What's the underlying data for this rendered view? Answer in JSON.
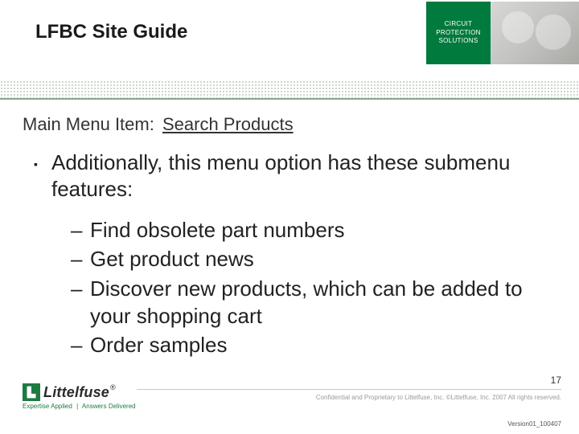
{
  "header": {
    "title": "LFBC Site Guide",
    "brand_lines": [
      "CIRCUIT",
      "PROTECTION",
      "SOLUTIONS"
    ]
  },
  "subhead": {
    "label": "Main Menu Item:",
    "value": "Search Products"
  },
  "bullet": "Additionally, this menu option has these submenu features:",
  "subitems": [
    "Find obsolete part numbers",
    "Get product news",
    "Discover new products, which can be added to your shopping cart",
    "Order samples"
  ],
  "footer": {
    "logo_word": "Littelfuse",
    "reg": "®",
    "tagline_left": "Expertise Applied",
    "tagline_right": "Answers Delivered",
    "page": "17",
    "legal": "Confidential and Proprietary to Littelfuse, Inc. ©Littelfuse, Inc. 2007 All rights reserved.",
    "version": "Version01_100407"
  }
}
